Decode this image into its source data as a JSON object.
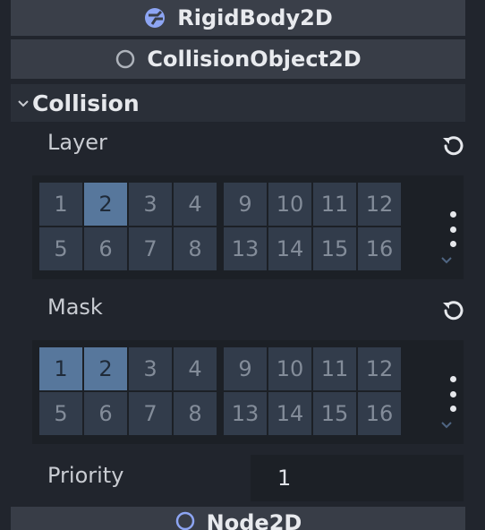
{
  "headers": {
    "rigidbody": "RigidBody2D",
    "collision_object": "CollisionObject2D",
    "node2d": "Node2D"
  },
  "section": {
    "label": "Collision",
    "expanded": true
  },
  "layer": {
    "label": "Layer",
    "active_bits": [
      2
    ],
    "cells": [
      {
        "n": "1",
        "on": false
      },
      {
        "n": "2",
        "on": true
      },
      {
        "n": "3",
        "on": false
      },
      {
        "n": "4",
        "on": false
      },
      {
        "n": "9",
        "on": false
      },
      {
        "n": "10",
        "on": false
      },
      {
        "n": "11",
        "on": false
      },
      {
        "n": "12",
        "on": false
      },
      {
        "n": "5",
        "on": false
      },
      {
        "n": "6",
        "on": false
      },
      {
        "n": "7",
        "on": false
      },
      {
        "n": "8",
        "on": false
      },
      {
        "n": "13",
        "on": false
      },
      {
        "n": "14",
        "on": false
      },
      {
        "n": "15",
        "on": false
      },
      {
        "n": "16",
        "on": false
      }
    ]
  },
  "mask": {
    "label": "Mask",
    "active_bits": [
      1,
      2
    ],
    "cells": [
      {
        "n": "1",
        "on": true
      },
      {
        "n": "2",
        "on": true
      },
      {
        "n": "3",
        "on": false
      },
      {
        "n": "4",
        "on": false
      },
      {
        "n": "9",
        "on": false
      },
      {
        "n": "10",
        "on": false
      },
      {
        "n": "11",
        "on": false
      },
      {
        "n": "12",
        "on": false
      },
      {
        "n": "5",
        "on": false
      },
      {
        "n": "6",
        "on": false
      },
      {
        "n": "7",
        "on": false
      },
      {
        "n": "8",
        "on": false
      },
      {
        "n": "13",
        "on": false
      },
      {
        "n": "14",
        "on": false
      },
      {
        "n": "15",
        "on": false
      },
      {
        "n": "16",
        "on": false
      }
    ]
  },
  "priority": {
    "label": "Priority",
    "value": "1"
  },
  "colors": {
    "background": "#21252d",
    "header": "#383d47",
    "cell_off": "#323c4b",
    "cell_on": "#57779c",
    "rigidbody_icon": "#8da5f3"
  },
  "icons": {
    "rigidbody": "rigidbody2d-icon",
    "collision_object": "collision-object-icon",
    "node2d": "node2d-icon",
    "revert": "revert-icon",
    "menu": "kebab-menu-icon",
    "more": "chevron-down-icon"
  }
}
